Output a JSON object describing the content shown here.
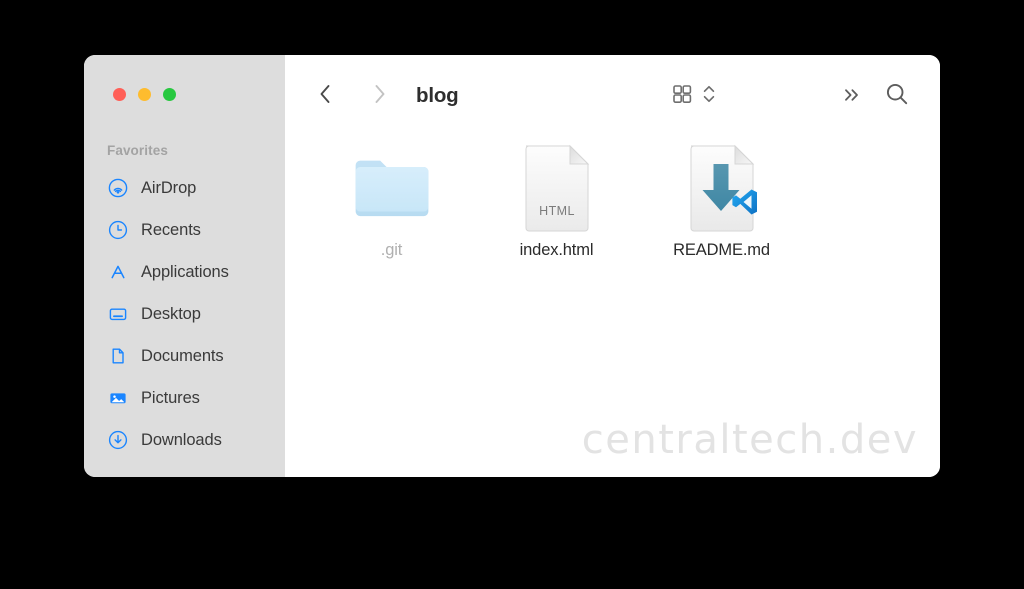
{
  "window": {
    "traffic_lights": [
      {
        "name": "close",
        "color": "#ff5f57"
      },
      {
        "name": "minimize",
        "color": "#febc2e"
      },
      {
        "name": "maximize",
        "color": "#28c840"
      }
    ]
  },
  "sidebar": {
    "section_header": "Favorites",
    "items": [
      {
        "label": "AirDrop",
        "icon": "airdrop-icon"
      },
      {
        "label": "Recents",
        "icon": "clock-icon"
      },
      {
        "label": "Applications",
        "icon": "applications-icon"
      },
      {
        "label": "Desktop",
        "icon": "desktop-icon"
      },
      {
        "label": "Documents",
        "icon": "document-icon"
      },
      {
        "label": "Pictures",
        "icon": "pictures-icon"
      },
      {
        "label": "Downloads",
        "icon": "download-circle-icon"
      }
    ]
  },
  "toolbar": {
    "back_icon": "chevron-left-icon",
    "forward_icon": "chevron-right-icon",
    "title": "blog",
    "grid_view_icon": "grid-view-icon",
    "stepper_icon": "chevron-up-down-icon",
    "overflow_icon": "double-chevron-right-icon",
    "search_icon": "search-icon"
  },
  "files": [
    {
      "name": ".git",
      "kind": "folder",
      "dimmed": true,
      "badge": "",
      "doc_label": ""
    },
    {
      "name": "index.html",
      "kind": "document",
      "dimmed": false,
      "badge": "",
      "doc_label": "HTML"
    },
    {
      "name": "README.md",
      "kind": "document-arrow",
      "dimmed": false,
      "badge": "vscode-badge",
      "doc_label": ""
    }
  ],
  "watermark": {
    "text": "centraltech.dev"
  },
  "colors": {
    "accent_blue": "#1a85ff",
    "sidebar_bg": "#dddddd",
    "folder_blue": "#aadcf7",
    "arrow_teal": "#4a90ab"
  }
}
